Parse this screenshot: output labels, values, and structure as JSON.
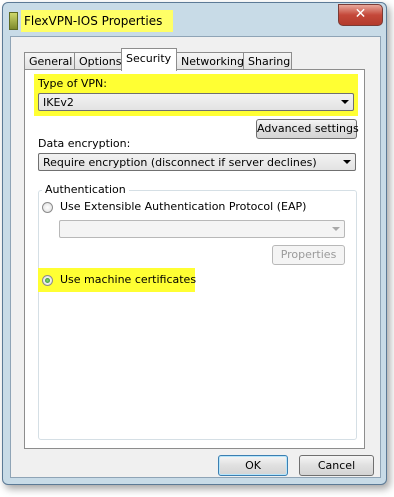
{
  "window": {
    "title": "FlexVPN-IOS Properties",
    "close_glyph": "✕"
  },
  "tabs": [
    {
      "label": "General"
    },
    {
      "label": "Options"
    },
    {
      "label": "Security"
    },
    {
      "label": "Networking"
    },
    {
      "label": "Sharing"
    }
  ],
  "active_tab": "Security",
  "security": {
    "vpn_type_label": "Type of VPN:",
    "vpn_type_value": "IKEv2",
    "advanced_settings_label": "Advanced settings",
    "data_encryption_label": "Data encryption:",
    "data_encryption_value": "Require encryption (disconnect if server declines)",
    "authentication": {
      "group_label": "Authentication",
      "eap_option_label": "Use Extensible Authentication Protocol (EAP)",
      "eap_selected": false,
      "eap_method_value": "",
      "properties_label": "Properties",
      "machine_cert_label": "Use machine certificates",
      "machine_cert_selected": true
    }
  },
  "footer": {
    "ok_label": "OK",
    "cancel_label": "Cancel"
  },
  "colors": {
    "highlight": "#ffff33",
    "frame": "#c8dbe7"
  }
}
